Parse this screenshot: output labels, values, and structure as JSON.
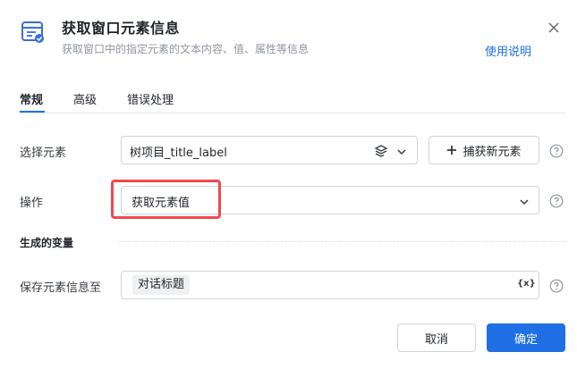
{
  "header": {
    "title": "获取窗口元素信息",
    "subtitle": "获取窗口中的指定元素的文本内容、值、属性等信息",
    "help_link": "使用说明",
    "icon": "window-element-icon",
    "close_icon": "close-icon"
  },
  "tabs": [
    {
      "label": "常规",
      "active": true
    },
    {
      "label": "高级",
      "active": false
    },
    {
      "label": "错误处理",
      "active": false
    }
  ],
  "form": {
    "select_element": {
      "label": "选择元素",
      "value": "树项目_title_label",
      "capture_button": "捕获新元素"
    },
    "operation": {
      "label": "操作",
      "value": "获取元素值"
    },
    "output_section": "生成的变量",
    "save_to": {
      "label": "保存元素信息至",
      "tag": "对话标题",
      "var_icon_text": "{x}"
    }
  },
  "footer": {
    "cancel": "取消",
    "confirm": "确定"
  },
  "colors": {
    "primary": "#1f6fe5",
    "highlight": "#f0494c"
  }
}
